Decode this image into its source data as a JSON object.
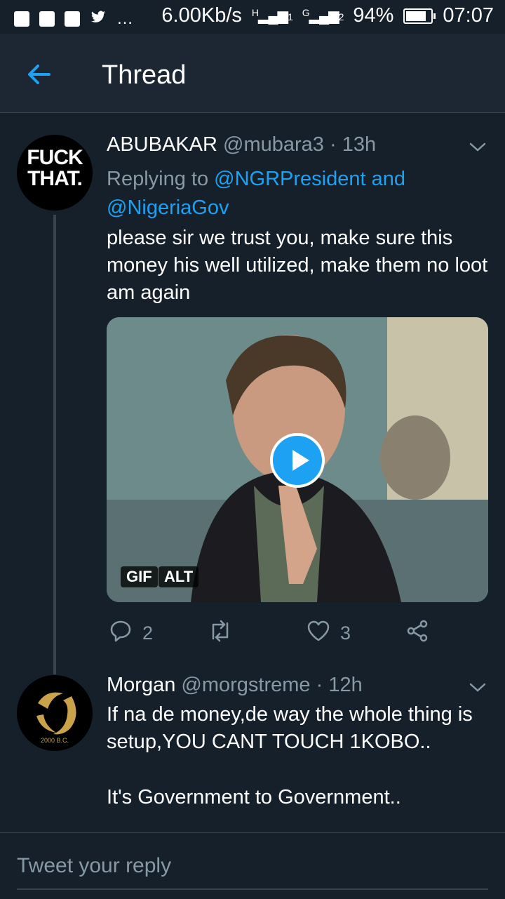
{
  "status_bar": {
    "speed": "6.00Kb/s",
    "sim1": "H",
    "sim2": "G",
    "sig1_num": "1",
    "sig2_num": "2",
    "battery": "94%",
    "battery_level": 0.94,
    "time": "07:07"
  },
  "header": {
    "title": "Thread"
  },
  "tweets": [
    {
      "name": "ABUBAKAR",
      "handle": "@mubara3",
      "sep": "·",
      "time": "13h",
      "replying_prefix": "Replying to",
      "replying_to_1": "@NGRPresident and",
      "replying_to_2": "@NigeriaGov",
      "text": "please sir we trust you, make sure this money his well utilized, make them no loot am again",
      "avatar_text_1": "FUCK",
      "avatar_text_2": "THAT.",
      "media_badges": [
        "GIF",
        "ALT"
      ],
      "replies": "2",
      "retweets": "",
      "likes": "3"
    },
    {
      "name": "Morgan",
      "handle": "@morgstreme",
      "sep": "·",
      "time": "12h",
      "text_1": "If na de money,de way the whole thing is setup,YOU CANT TOUCH 1KOBO..",
      "text_2": "It's Government to Government..",
      "avatar_text": "2000 B.C."
    }
  ],
  "reply_box": {
    "placeholder": "Tweet your reply"
  },
  "colors": {
    "background": "#15202b",
    "accent": "#1da1f2",
    "muted": "#8899a6"
  }
}
